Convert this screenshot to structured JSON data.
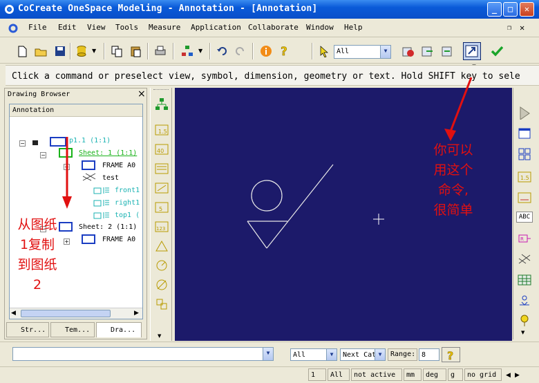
{
  "window": {
    "title": "CoCreate OneSpace Modeling - Annotation - [Annotation]",
    "minimize": "_",
    "maximize": "□",
    "close": "✕"
  },
  "menu": {
    "items": [
      "File",
      "Edit",
      "View",
      "Tools",
      "Measure",
      "Application",
      "Collaborate",
      "Window",
      "Help"
    ]
  },
  "toolbar": {
    "filter_value": "All"
  },
  "prompt": {
    "text": "Click a command or preselect view, symbol, dimension, geometry or text. Hold SHIFT key to sele"
  },
  "browser": {
    "title": "Drawing Browser",
    "close": "×",
    "tree_header": "Annotation",
    "nodes": {
      "root": "p1.1 (1:1)",
      "sheet1": "Sheet: 1 (1:1)",
      "frame1": "FRAME A0",
      "test": "test",
      "front": "front1",
      "right": "right1",
      "top": "top1 (",
      "sheet2": "Sheet: 2 (1:1)",
      "frame2": "FRAME A0"
    },
    "tabs": [
      "Str...",
      "Tem...",
      "Dra..."
    ]
  },
  "annotations": {
    "left": [
      "从图纸",
      "1复制",
      "到图纸",
      "2"
    ],
    "right": [
      "你可以",
      "用这个",
      "命令,",
      "很简单"
    ]
  },
  "right_toolbar": {
    "abc_label": "ABC"
  },
  "cmdbar": {
    "input_value": "",
    "filter_value": "All",
    "next_label": "Next Cat",
    "range_label": "Range:",
    "range_value": "8"
  },
  "status": {
    "count": "1",
    "all": "All",
    "active": "not active",
    "unit_length": "mm",
    "unit_angle": "deg",
    "unit_mass": "g",
    "grid": "no grid"
  },
  "colors": {
    "canvas_bg": "#1c1a6a",
    "annotation_red": "#e11010",
    "titlebar_blue": "#0a5ad8"
  }
}
